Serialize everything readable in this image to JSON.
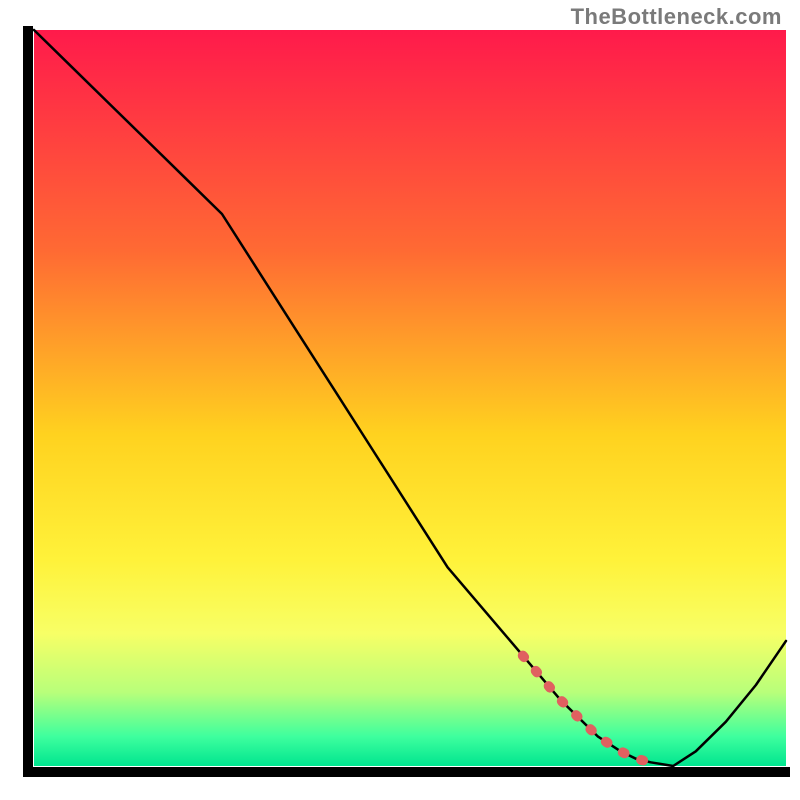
{
  "watermark": "TheBottleneck.com",
  "chart_data": {
    "type": "line",
    "title": "",
    "xlabel": "",
    "ylabel": "",
    "xlim": [
      0,
      100
    ],
    "ylim": [
      0,
      100
    ],
    "x": [
      0,
      5,
      10,
      15,
      20,
      25,
      30,
      35,
      40,
      45,
      50,
      55,
      60,
      65,
      70,
      75,
      78,
      80,
      82,
      85,
      88,
      92,
      96,
      100
    ],
    "values": [
      100,
      95,
      90,
      85,
      80,
      75,
      67,
      59,
      51,
      43,
      35,
      27,
      21,
      15,
      9,
      4,
      2,
      1,
      0.5,
      0,
      2,
      6,
      11,
      17
    ],
    "annotations": {
      "dotted_segment_x_range": [
        62,
        83
      ],
      "dotted_segment_description": "thicker red dotted overlay along the main line near the minimum"
    },
    "background": {
      "type": "vertical-gradient",
      "stops": [
        {
          "pos": 0.0,
          "color": "#ff1a4b"
        },
        {
          "pos": 0.3,
          "color": "#ff6a33"
        },
        {
          "pos": 0.55,
          "color": "#ffd21f"
        },
        {
          "pos": 0.72,
          "color": "#fff23a"
        },
        {
          "pos": 0.82,
          "color": "#f7ff66"
        },
        {
          "pos": 0.9,
          "color": "#b8ff7a"
        },
        {
          "pos": 0.96,
          "color": "#3eff9e"
        },
        {
          "pos": 1.0,
          "color": "#00e58f"
        }
      ]
    }
  }
}
